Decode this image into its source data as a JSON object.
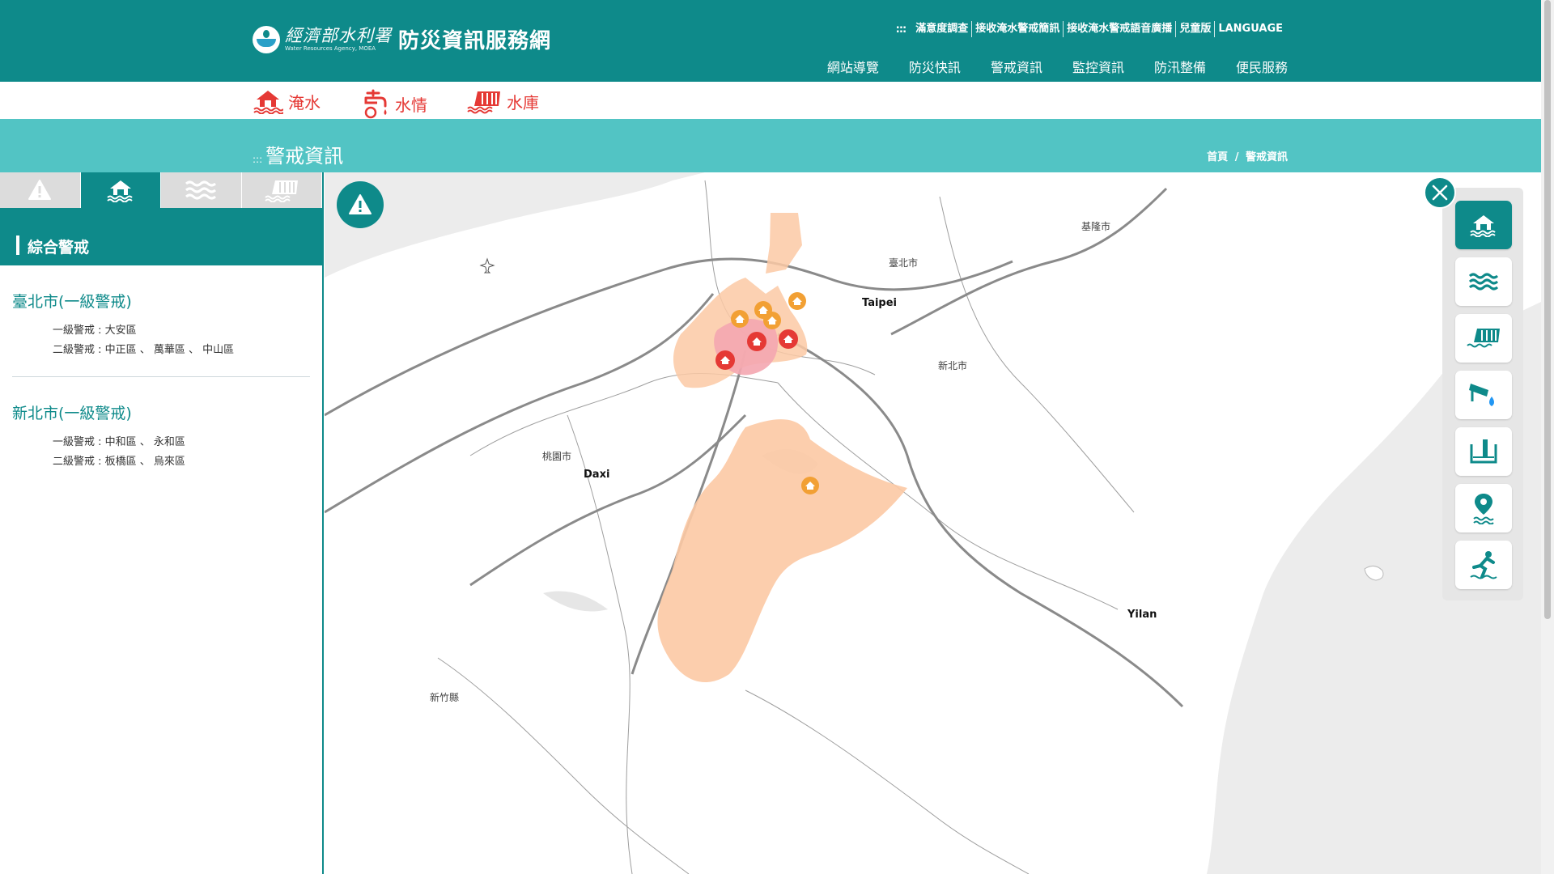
{
  "header": {
    "agency_name": "經濟部水利署",
    "agency_name_en": "Water Resources Agency, MOEA",
    "site_title": "防災資訊服務網",
    "util_nav_marker": ":::",
    "util_nav": [
      "滿意度調查",
      "接收淹水警戒簡訊",
      "接收淹水警戒語音廣播",
      "兒童版",
      "LANGUAGE"
    ],
    "main_nav": [
      "網站導覽",
      "防災快訊",
      "警戒資訊",
      "監控資訊",
      "防汛整備",
      "便民服務"
    ]
  },
  "sub_nav": [
    {
      "label": "淹水",
      "icon": "flood-house-icon"
    },
    {
      "label": "水情",
      "icon": "faucet-icon"
    },
    {
      "label": "水庫",
      "icon": "reservoir-dam-icon"
    }
  ],
  "page": {
    "title_marker": ":::",
    "title": "警戒資訊",
    "breadcrumb": {
      "home": "首頁",
      "sep": "/",
      "current": "警戒資訊"
    }
  },
  "left_panel": {
    "tabs": [
      {
        "icon": "warning-icon",
        "active": false
      },
      {
        "icon": "flood-house-icon",
        "active": true
      },
      {
        "icon": "water-waves-icon",
        "active": false
      },
      {
        "icon": "reservoir-dam-icon",
        "active": false
      }
    ],
    "section_title": "綜合警戒",
    "regions": [
      {
        "name": "臺北市(一級警戒)",
        "level1": "一級警戒 : 大安區",
        "level2": "二級警戒 : 中正區 、 萬華區 、 中山區"
      },
      {
        "name": "新北市(一級警戒)",
        "level1": "一級警戒 : 中和區 、 永和區",
        "level2": "二級警戒 : 板橋區 、 烏來區"
      }
    ]
  },
  "map": {
    "labels": {
      "keelung": "基隆市",
      "taipei_city": "臺北市",
      "taipei": "Taipei",
      "new_taipei": "新北市",
      "taoyuan": "桃園市",
      "daxi": "Daxi",
      "yilan": "Yilan",
      "hsinchu": "新竹縣"
    },
    "colors": {
      "level1": "#f4a6b0",
      "level2": "#fcc9a4",
      "marker_red": "#e53935",
      "marker_orange": "#f2a034"
    }
  },
  "right_tools": [
    {
      "icon": "flood-house-icon",
      "active": true
    },
    {
      "icon": "water-waves-icon",
      "active": false
    },
    {
      "icon": "reservoir-dam-icon",
      "active": false
    },
    {
      "icon": "cctv-camera-icon",
      "active": false
    },
    {
      "icon": "water-gauge-icon",
      "active": false
    },
    {
      "icon": "location-water-icon",
      "active": false
    },
    {
      "icon": "evacuation-person-icon",
      "active": false
    }
  ],
  "colors": {
    "primary": "#0e8a8a",
    "title_band": "#52c4c4",
    "alert_red": "#e53935"
  }
}
